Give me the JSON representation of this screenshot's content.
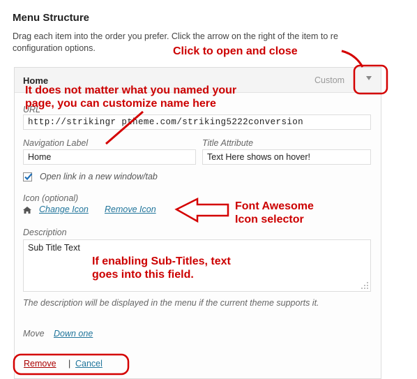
{
  "section_title": "Menu Structure",
  "intro_line1": "Drag each item into the order you prefer. Click the arrow on the right of the item to re",
  "intro_line2": "configuration options.",
  "menu_item": {
    "title": "Home",
    "type_label": "Custom",
    "toggle_icon": "triangle-down-icon",
    "url_label": "URL",
    "url_value": "http://strikingr  ptheme.com/striking5222conversion",
    "nav_label_label": "Navigation Label",
    "nav_label_value": "Home",
    "title_attr_label": "Title Attribute",
    "title_attr_value": "Text Here shows on hover!",
    "open_new_window_label": "Open link in a new window/tab",
    "open_new_window_checked": true,
    "icon_label": "Icon (optional)",
    "icon_name": "home-icon",
    "change_icon_label": "Change Icon",
    "remove_icon_label": "Remove Icon",
    "description_label": "Description",
    "description_value": "Sub Title Text",
    "description_note": "The description will be displayed in the menu if the current theme supports it.",
    "move_label": "Move",
    "move_down_label": "Down one",
    "remove_label": "Remove",
    "separator": "|",
    "cancel_label": "Cancel"
  },
  "annotations": {
    "open_close": "Click to open and close",
    "name_line1": "It does not matter what you named your",
    "name_line2": "page, you can customize name here",
    "font_awesome_line1": "Font Awesome",
    "font_awesome_line2": "Icon selector",
    "subtitle_line1": "If enabling Sub-Titles, text",
    "subtitle_line2": "goes into this field."
  },
  "colors": {
    "annotation_red": "#cc0000",
    "link_blue": "#21759b"
  }
}
